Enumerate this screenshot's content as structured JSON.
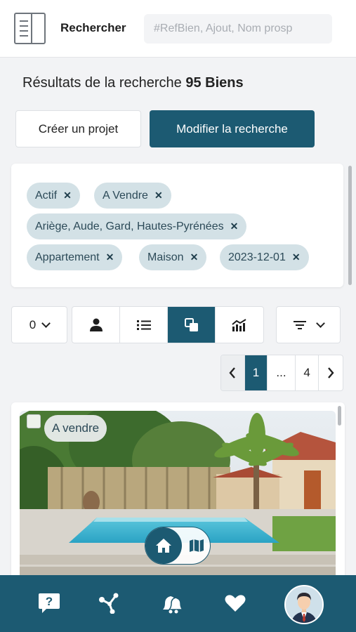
{
  "header": {
    "title": "Rechercher",
    "search_placeholder": "#RefBien, Ajout, Nom prosp",
    "menu_icon": "book-open-icon"
  },
  "results": {
    "prefix": "Résultats de la recherche",
    "count_label": "95 Biens"
  },
  "actions": {
    "create_label": "Créer un projet",
    "modify_label": "Modifier la recherche"
  },
  "filters": [
    {
      "label": "Actif"
    },
    {
      "label": "A Vendre"
    },
    {
      "label": "Ariège, Aude, Gard, Hautes-Pyrénées"
    },
    {
      "label": "Appartement"
    },
    {
      "label": "Maison"
    },
    {
      "label": "2023-12-01"
    }
  ],
  "toolbar": {
    "count_value": "0",
    "views": [
      {
        "icon": "person-icon",
        "active": false
      },
      {
        "icon": "list-icon",
        "active": false
      },
      {
        "icon": "cards-icon",
        "active": true
      },
      {
        "icon": "stats-chart-icon",
        "active": false
      }
    ],
    "sort_icon": "filter-icon"
  },
  "pagination": {
    "prev": "‹",
    "current": "1",
    "ellipsis": "...",
    "last": "4",
    "next": "›"
  },
  "listing": {
    "status": "A vendre",
    "toggle": {
      "left_icon": "home-icon",
      "right_icon": "map-icon",
      "active": "home"
    }
  },
  "bottom_nav": [
    {
      "icon": "help-icon"
    },
    {
      "icon": "network-icon"
    },
    {
      "icon": "bell-icon"
    },
    {
      "icon": "heart-icon"
    },
    {
      "icon": "avatar-icon"
    }
  ],
  "colors": {
    "primary": "#1c5a72",
    "chip_bg": "#d3e1e6",
    "background": "#f2f3f5"
  }
}
